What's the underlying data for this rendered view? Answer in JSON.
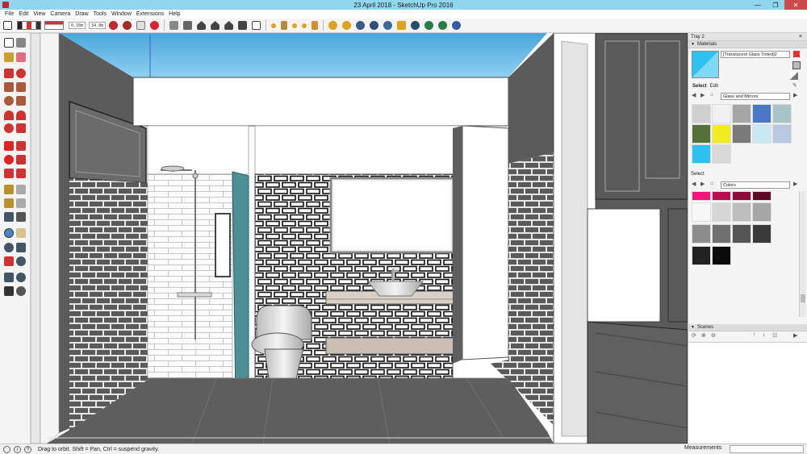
{
  "window": {
    "title": "23 April 2018 - SketchUp Pro 2016",
    "minimize": "—",
    "maximize": "❐",
    "close": "✕"
  },
  "menu": [
    "File",
    "Edit",
    "View",
    "Camera",
    "Draw",
    "Tools",
    "Window",
    "Extensions",
    "Help"
  ],
  "toolbar": {
    "readout_a": "0.18m",
    "readout_b": "34.8m"
  },
  "tray": {
    "title": "Tray 2",
    "materials": {
      "header": "Materials",
      "current_material": "[Translucent Glass Tinted]2",
      "tabs": [
        "Select",
        "Edit"
      ],
      "library": "Glass and Mirrors",
      "swatches": [
        "#cfcfcf",
        "#f1f1f1",
        "#a5a5a5",
        "#4a78c8",
        "#a9c4c9",
        "#55703a",
        "#f2ec1e",
        "#7a7a7a",
        "#c8e8f5",
        "#b8c8e0",
        "#2fc0f0",
        "#d8d8d8"
      ]
    },
    "colors": {
      "select_label": "Select",
      "library": "Colors",
      "swatches": [
        "#f0167a",
        "#b8104f",
        "#8c0a38",
        "#5f0a24",
        "#f7f7f7",
        "#d6d6d6",
        "#bdbdbd",
        "#a6a6a6",
        "#8c8c8c",
        "#707070",
        "#555555",
        "#3a3a3a",
        "#222222",
        "#0b0b0b"
      ]
    },
    "scenes": {
      "header": "Scenes"
    }
  },
  "statusbar": {
    "hint": "Drag to orbit. Shift = Pan, Ctrl = suspend gravity.",
    "measurements_label": "Measurements",
    "info_icon": "i",
    "help_icon": "?"
  }
}
